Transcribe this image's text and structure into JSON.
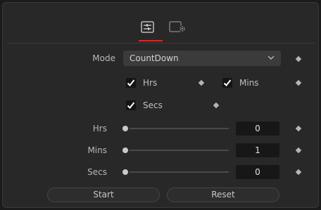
{
  "tabs": [
    {
      "icon": "sliders-tab-icon",
      "active": true
    },
    {
      "icon": "settings-tab-icon",
      "active": false
    }
  ],
  "accent": "#d22a2a",
  "mode": {
    "label": "Mode",
    "value": "CountDown"
  },
  "checkboxes": {
    "hrs": {
      "label": "Hrs",
      "checked": true
    },
    "mins": {
      "label": "Mins",
      "checked": true
    },
    "secs": {
      "label": "Secs",
      "checked": true
    }
  },
  "sliders": {
    "hrs": {
      "label": "Hrs",
      "value": "0"
    },
    "mins": {
      "label": "Mins",
      "value": "1"
    },
    "secs": {
      "label": "Secs",
      "value": "0"
    }
  },
  "buttons": {
    "start": "Start",
    "reset": "Reset"
  }
}
